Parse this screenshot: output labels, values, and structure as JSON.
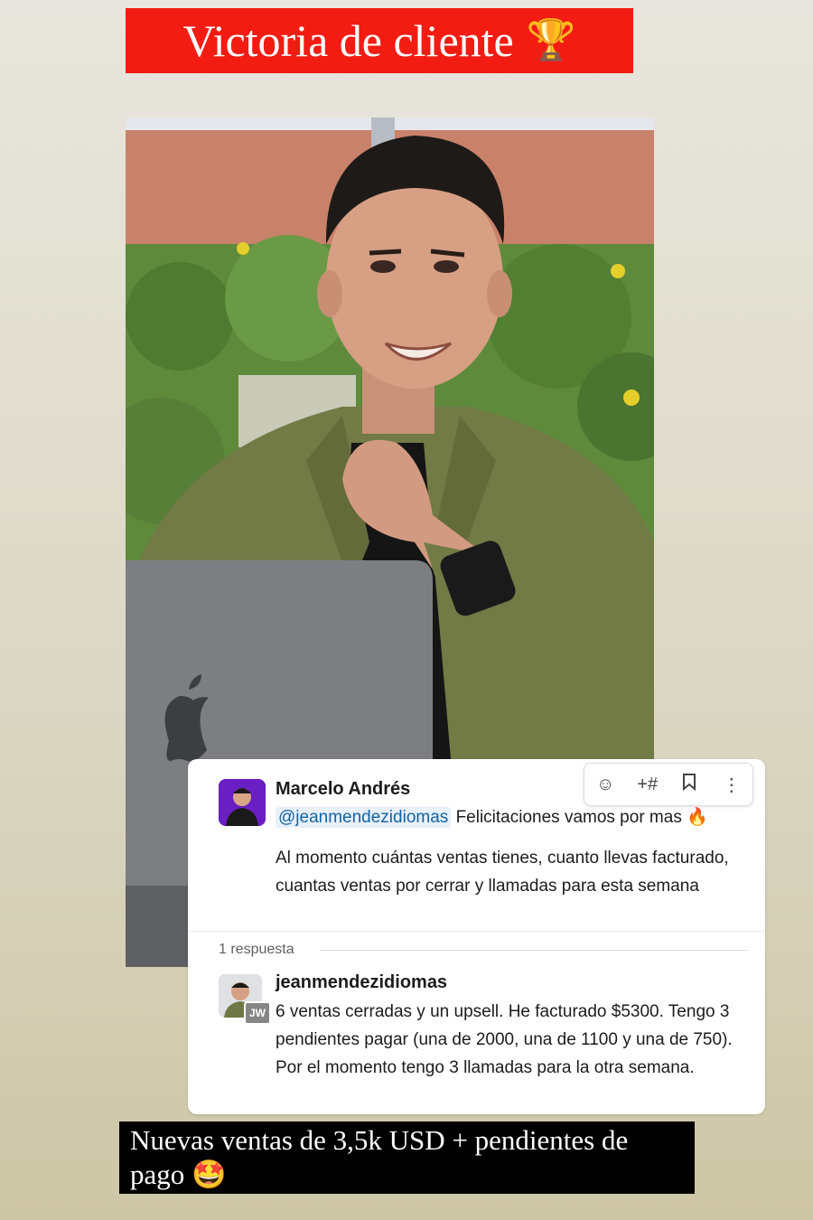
{
  "header": {
    "title": "Victoria de cliente",
    "trophy_icon": "🏆"
  },
  "photo": {
    "description_icon": "person-photo"
  },
  "slack": {
    "sender": "Marcelo Andrés",
    "mention": "@jeanmendezidiomas",
    "line1_text": "Felicitaciones vamos por mas",
    "fire_icon": "🔥",
    "body": "Al momento cuántas ventas tienes, cuanto llevas facturado, cuantas ventas por cerrar y llamadas para esta semana",
    "toolbar": {
      "emoji_icon": "☺",
      "channel_icon": "+#",
      "bookmark_icon": "🔖",
      "more_icon": "⋮"
    },
    "reply_count": "1 respuesta",
    "reply": {
      "name": "jeanmendezidiomas",
      "badge": "JW",
      "body": "6 ventas cerradas y un upsell. He facturado $5300. Tengo 3 pendientes pagar (una de 2000, una de 1100 y una de 750). Por el momento tengo 3 llamadas para la otra semana."
    }
  },
  "caption": {
    "text": "Nuevas ventas de 3,5k USD + pendientes de pago",
    "emoji": "🤩"
  }
}
